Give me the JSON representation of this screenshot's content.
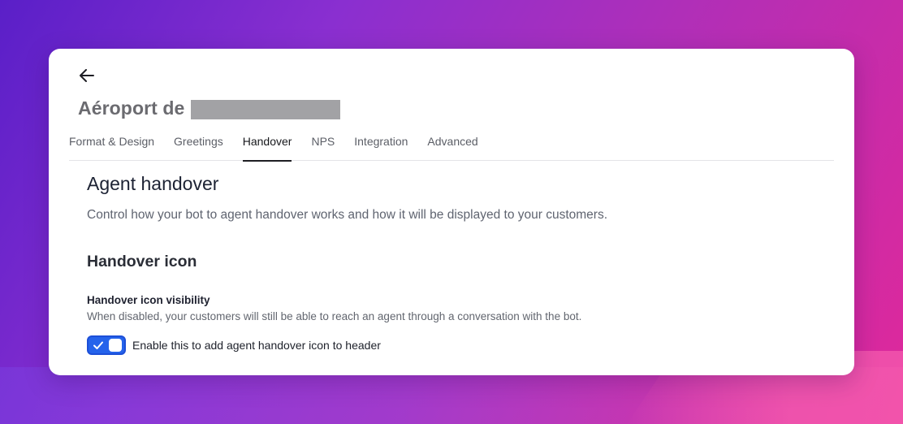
{
  "header": {
    "title": "Aéroport de"
  },
  "tabs": [
    {
      "label": "Format & Design"
    },
    {
      "label": "Greetings"
    },
    {
      "label": "Handover"
    },
    {
      "label": "NPS"
    },
    {
      "label": "Integration"
    },
    {
      "label": "Advanced"
    }
  ],
  "active_tab": "Handover",
  "section": {
    "title": "Agent handover",
    "description": "Control how your bot to agent handover works and how it will be displayed to your customers."
  },
  "subsection": {
    "title": "Handover icon"
  },
  "field": {
    "label": "Handover icon visibility",
    "help": "When disabled, your customers will still be able to reach an agent through a conversation with the bot.",
    "toggle_label": "Enable this to add agent handover icon to header",
    "toggle_on": true
  },
  "colors": {
    "accent": "#2563eb",
    "title_gray": "#6b6b70"
  },
  "icons": {
    "back": "arrow-left-icon",
    "toggle_check": "check-icon"
  }
}
